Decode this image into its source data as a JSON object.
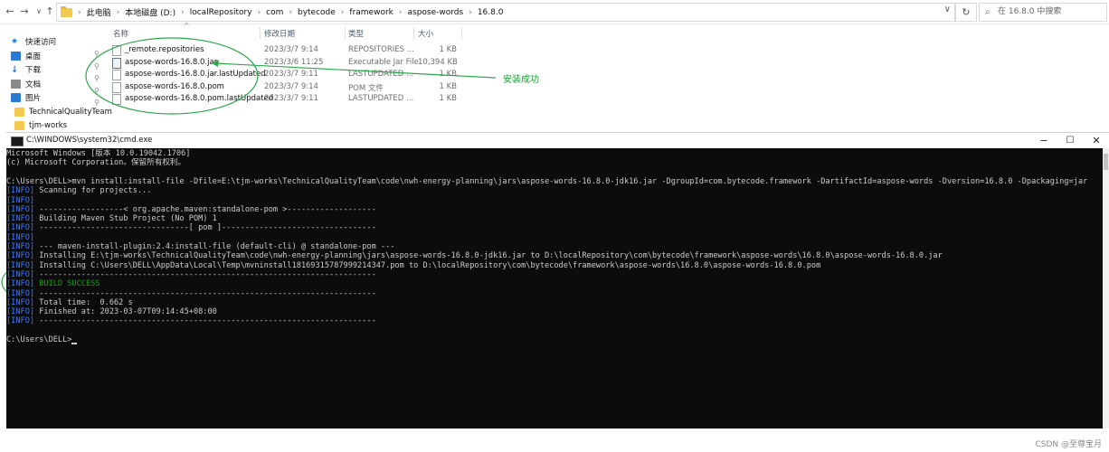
{
  "explorer": {
    "breadcrumbs": [
      "此电脑",
      "本地磁盘 (D:)",
      "localRepository",
      "com",
      "bytecode",
      "framework",
      "aspose-words",
      "16.8.0"
    ],
    "search_placeholder": "在 16.8.0 中搜索",
    "nav_items": [
      {
        "label": "快速访问",
        "icon": "star-icon",
        "color": "#1e7bd6"
      },
      {
        "label": "桌面",
        "icon": "desktop-icon",
        "color": "#2b79d0"
      },
      {
        "label": "下载",
        "icon": "download-icon",
        "color": "#2b79d0"
      },
      {
        "label": "文档",
        "icon": "documents-icon",
        "color": "#8a8a8a"
      },
      {
        "label": "图片",
        "icon": "pictures-icon",
        "color": "#2b79d0"
      },
      {
        "label": "TechnicalQualityTeam",
        "icon": "folder-icon",
        "color": "#f3c94f"
      },
      {
        "label": "tjm-works",
        "icon": "folder-icon",
        "color": "#f3c94f"
      }
    ],
    "columns": {
      "name": "名称",
      "date": "修改日期",
      "type": "类型",
      "size": "大小"
    },
    "files": [
      {
        "name": "_remote.repositories",
        "date": "2023/3/7 9:14",
        "type": "REPOSITORIES ...",
        "size": "1 KB",
        "icon": "file-icon"
      },
      {
        "name": "aspose-words-16.8.0.jar",
        "date": "2023/3/6 11:25",
        "type": "Executable Jar File",
        "size": "10,394 KB",
        "icon": "jar-file-icon"
      },
      {
        "name": "aspose-words-16.8.0.jar.lastUpdated",
        "date": "2023/3/7 9:11",
        "type": "LASTUPDATED ...",
        "size": "1 KB",
        "icon": "file-icon"
      },
      {
        "name": "aspose-words-16.8.0.pom",
        "date": "2023/3/7 9:14",
        "type": "POM 文件",
        "size": "1 KB",
        "icon": "file-icon"
      },
      {
        "name": "aspose-words-16.8.0.pom.lastUpdated",
        "date": "2023/3/7 9:11",
        "type": "LASTUPDATED ...",
        "size": "1 KB",
        "icon": "file-icon"
      }
    ],
    "annotation": "安装成功",
    "annotation_color": "#1a9e3a"
  },
  "cmd": {
    "title": "C:\\WINDOWS\\system32\\cmd.exe",
    "lines": [
      {
        "text": "Microsoft Windows [版本 10.0.19042.1706]",
        "style": "plain"
      },
      {
        "text": "(c) Microsoft Corporation。保留所有权利。",
        "style": "plain"
      },
      {
        "text": "",
        "style": "plain"
      },
      {
        "text": "C:\\Users\\DELL>mvn install:install-file -Dfile=E:\\tjm-works\\TechnicalQualityTeam\\code\\nwh-energy-planning\\jars\\aspose-words-16.8.0-jdk16.jar -DgroupId=com.bytecode.framework -DartifactId=aspose-words -Dversion=16.8.0 -Dpackaging=jar",
        "style": "plain"
      },
      {
        "text": "Scanning for projects...",
        "style": "info"
      },
      {
        "text": "",
        "style": "info"
      },
      {
        "text": "------------------< org.apache.maven:standalone-pom >-------------------",
        "style": "info"
      },
      {
        "text": "Building Maven Stub Project (No POM) 1",
        "style": "info"
      },
      {
        "text": "--------------------------------[ pom ]---------------------------------",
        "style": "info"
      },
      {
        "text": "",
        "style": "info"
      },
      {
        "text": "--- maven-install-plugin:2.4:install-file (default-cli) @ standalone-pom ---",
        "style": "info"
      },
      {
        "text": "Installing E:\\tjm-works\\TechnicalQualityTeam\\code\\nwh-energy-planning\\jars\\aspose-words-16.8.0-jdk16.jar to D:\\localRepository\\com\\bytecode\\framework\\aspose-words\\16.8.0\\aspose-words-16.8.0.jar",
        "style": "info"
      },
      {
        "text": "Installing C:\\Users\\DELL\\AppData\\Local\\Temp\\mvninstall1816931578799921434​7.pom to D:\\localRepository\\com\\bytecode\\framework\\aspose-words\\16.8.0\\aspose-words-16.8.0.pom",
        "style": "info"
      },
      {
        "text": "------------------------------------------------------------------------",
        "style": "info"
      },
      {
        "text": "BUILD SUCCESS",
        "style": "success"
      },
      {
        "text": "------------------------------------------------------------------------",
        "style": "info"
      },
      {
        "text": "Total time:  0.662 s",
        "style": "info"
      },
      {
        "text": "Finished at: 2023-03-07T09:14:45+08:00",
        "style": "info"
      },
      {
        "text": "------------------------------------------------------------------------",
        "style": "info"
      },
      {
        "text": "",
        "style": "plain"
      },
      {
        "text": "C:\\Users\\DELL>",
        "style": "prompt"
      }
    ],
    "info_prefix": "[INFO] ",
    "colors": {
      "background": "#0c0c0c",
      "text": "#cccccc",
      "info": "#3b78ff",
      "success": "#13a10e"
    }
  },
  "watermark": "CSDN @至尊宝月"
}
